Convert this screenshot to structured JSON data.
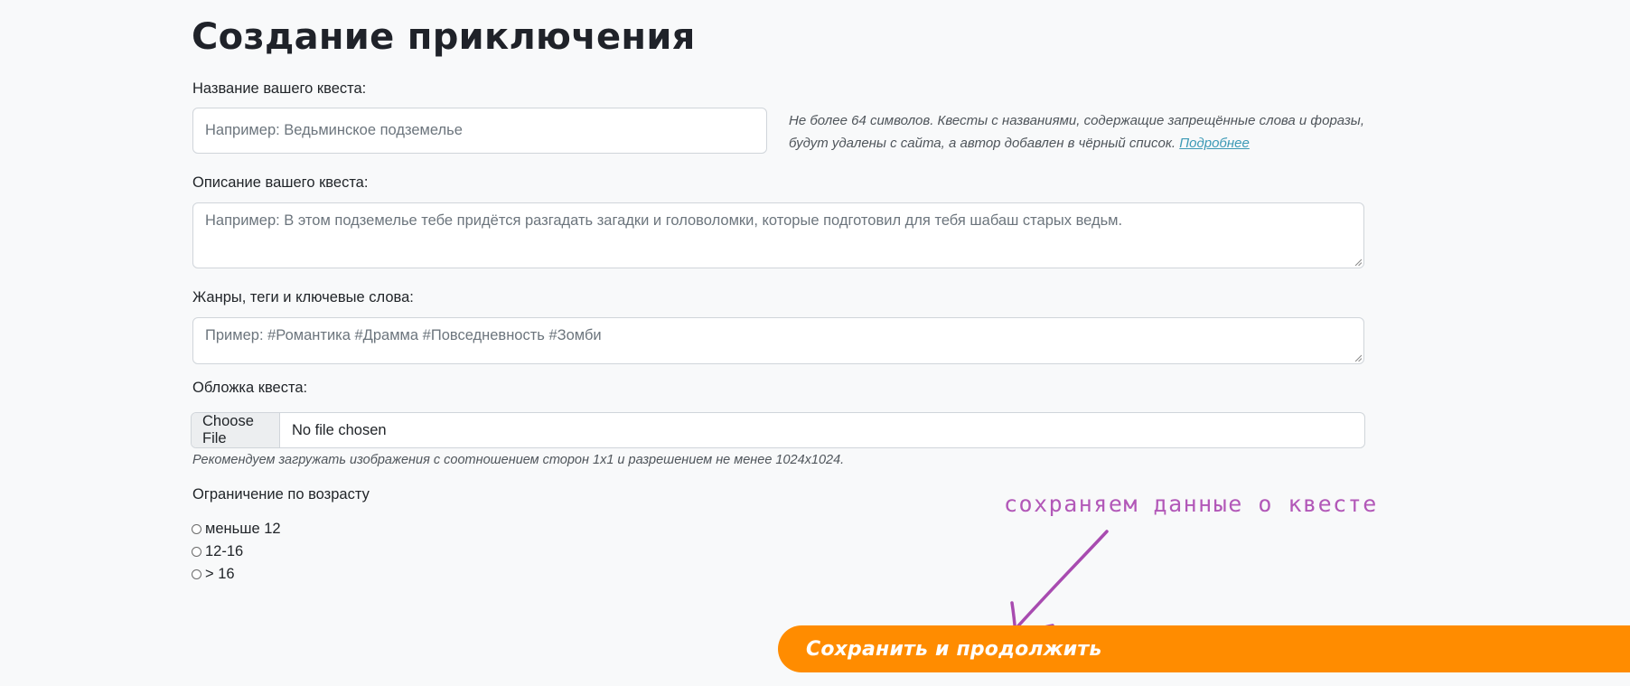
{
  "page": {
    "title": "Создание приключения"
  },
  "quest_name": {
    "label": "Название вашего квеста:",
    "placeholder": "Например: Ведьминское подземелье",
    "help_text": "Не более 64 символов. Квесты с названиями, содержащие запрещённые слова и форазы, будут удалены с сайта, а автор добавлен в чёрный список.",
    "help_link": "Подробнее"
  },
  "quest_description": {
    "label": "Описание вашего квеста:",
    "placeholder": "Например: В этом подземелье тебе придётся разгадать загадки и головоломки, которые подготовил для тебя шабаш старых ведьм."
  },
  "tags": {
    "label": "Жанры, теги и ключевые слова:",
    "placeholder": "Пример: #Романтика #Драмма #Повседневность #Зомби"
  },
  "cover": {
    "label": "Обложка квеста:",
    "button_label": "Choose File",
    "file_status": "No file chosen",
    "help_text": "Рекомендуем загружать изображения с соотношением сторон 1x1 и разрешением не менее 1024x1024."
  },
  "age_limit": {
    "label": "Ограничение по возрасту",
    "options": [
      "меньше 12",
      "12-16",
      "> 16"
    ]
  },
  "annotation": {
    "text": "сохраняем данные о квесте",
    "color": "#b258b8"
  },
  "actions": {
    "save_label": "Сохранить и продолжить",
    "save_color": "#ff8c00"
  }
}
